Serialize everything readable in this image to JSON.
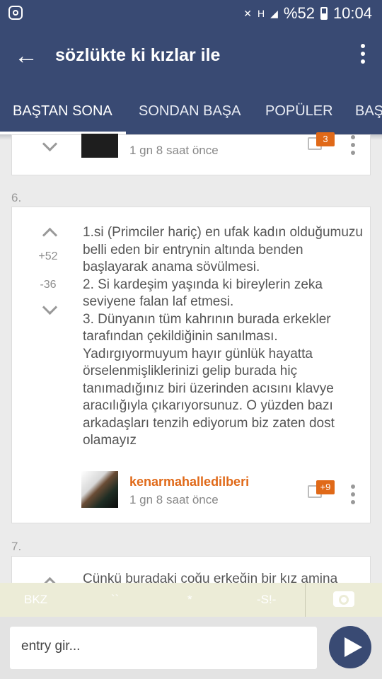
{
  "status": {
    "left_icon": "instagram-icon",
    "battery": "%52",
    "time": "10:04"
  },
  "app": {
    "title": "sözlükte ki kızlar ile",
    "back_icon": "arrow-left-icon",
    "more_icon": "more-vertical-icon"
  },
  "tabs": [
    {
      "label": "BAŞTAN SONA",
      "active": true
    },
    {
      "label": "SONDAN BAŞA",
      "active": false
    },
    {
      "label": "POPÜLER",
      "active": false
    },
    {
      "label": "BAŞ",
      "active": false
    }
  ],
  "entries": [
    {
      "time": "1 gn 8 saat önce",
      "comment_count": "3"
    },
    {
      "number": "6.",
      "upvotes": "+52",
      "downvotes": "-36",
      "text": "1.si (Primciler hariç) en ufak kadın olduğumuzu belli eden bir entrynin altında benden başlayarak anama sövülmesi.\n2. Si kardeşim yaşında ki bireylerin zeka seviyene falan laf etmesi.\n3. Dünyanın tüm kahrının burada erkekler tarafından çekildiğinin sanılması. Yadırgıyormuyum hayır günlük hayatta örselenmişliklerinizi gelip burada hiç tanımadığınız biri üzerinden acısını klavye aracılığıyla çıkarıyorsunuz. O yüzden bazı arkadaşları tenzih ediyorum biz zaten dost olamayız",
      "author": "kenarmahalledilberi",
      "time": "1 gn 8 saat önce",
      "comment_count": "+9"
    },
    {
      "number": "7.",
      "text": "Çünkü buradaki çoğu erkeğin bir kız amina"
    }
  ],
  "composer": {
    "tools": [
      "BKZ",
      "``",
      "*",
      "-S!-"
    ],
    "camera_icon": "camera-icon",
    "placeholder": "entry gir...",
    "send_icon": "send-icon"
  }
}
